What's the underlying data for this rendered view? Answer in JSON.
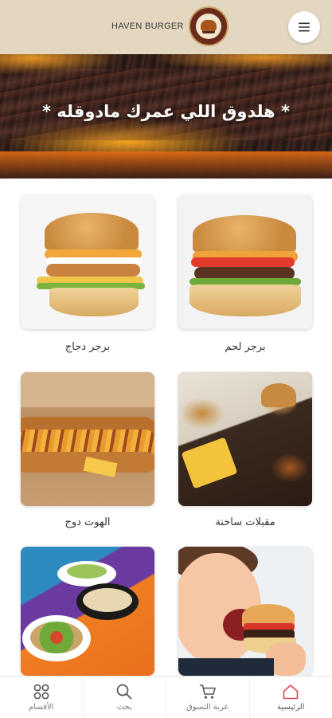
{
  "header": {
    "brand_text": "HAVEN BURGER",
    "logo_icon": "haven-burger-logo",
    "menu_icon": "hamburger-menu-icon"
  },
  "hero": {
    "title": "* هلدوق اللي عمرك مادوقله *"
  },
  "categories": [
    {
      "label": "برجر لحم",
      "image": "beef-burger-photo"
    },
    {
      "label": "برجر دجاج",
      "image": "chicken-burger-photo"
    },
    {
      "label": "مقبلات ساخنة",
      "image": "hot-appetizers-photo"
    },
    {
      "label": "الهوت دوج",
      "image": "hot-dog-photo"
    },
    {
      "label": "",
      "image": "kid-eating-burger-photo"
    },
    {
      "label": "",
      "image": "salads-photo"
    }
  ],
  "tabbar": {
    "items": [
      {
        "label": "الرئيسية",
        "icon": "home-icon",
        "active": true
      },
      {
        "label": "عربة التسوق",
        "icon": "cart-icon",
        "active": false
      },
      {
        "label": "بحث",
        "icon": "search-icon",
        "active": false
      },
      {
        "label": "الأقسام",
        "icon": "categories-grid-icon",
        "active": false
      }
    ]
  },
  "colors": {
    "header_bg": "#e4d7bf",
    "accent": "#e0475a",
    "text": "#333333"
  }
}
